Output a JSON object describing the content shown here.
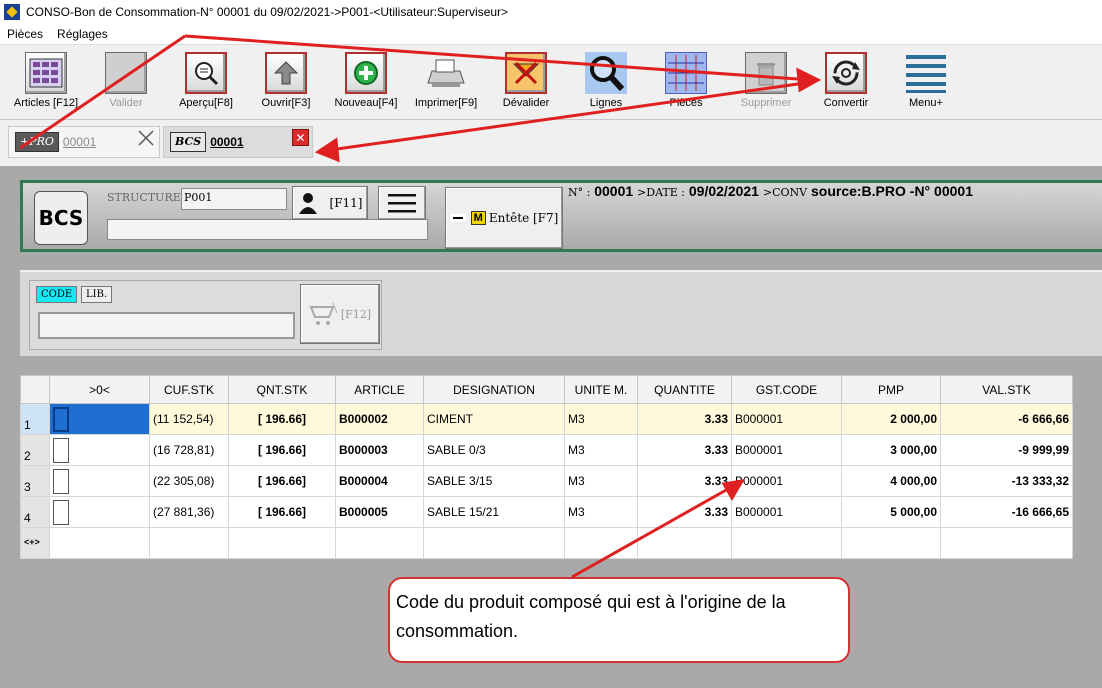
{
  "window": {
    "title": "CONSO-Bon de Consommation-N° 00001 du 09/02/2021->P001-<Utilisateur:Superviseur>"
  },
  "menu": [
    "Pièces",
    "Réglages"
  ],
  "toolbar": [
    {
      "label": "Articles [F12]",
      "icon": "articles-grid-icon",
      "enabled": true
    },
    {
      "label": "Valider",
      "icon": "validate-icon",
      "enabled": false
    },
    {
      "label": "Aperçu[F8]",
      "icon": "preview-magnifier-icon",
      "enabled": true
    },
    {
      "label": "Ouvrir[F3]",
      "icon": "open-arrow-icon",
      "enabled": true
    },
    {
      "label": "Nouveau[F4]",
      "icon": "new-plus-icon",
      "enabled": true
    },
    {
      "label": "Imprimer[F9]",
      "icon": "printer-icon",
      "enabled": true
    },
    {
      "label": "Dévalider",
      "icon": "devalidate-icon",
      "enabled": true
    },
    {
      "label": "Lignes",
      "icon": "lines-magnifier-icon",
      "enabled": true
    },
    {
      "label": "Pièces",
      "icon": "pieces-grid-icon",
      "enabled": true
    },
    {
      "label": "Supprimer",
      "icon": "delete-icon",
      "enabled": false
    },
    {
      "label": "Convertir",
      "icon": "convert-icon",
      "enabled": true
    },
    {
      "label": "Menu+",
      "icon": "menu-lines-icon",
      "enabled": true
    }
  ],
  "tabs": [
    {
      "badge": "+PRO",
      "number": "00001",
      "active": false
    },
    {
      "badge": "BCS",
      "number": "00001",
      "active": true
    }
  ],
  "header": {
    "logo": "BCS",
    "structure_label": "STRUCTURE",
    "structure_value": "P001",
    "user_shortcut": "[F11]",
    "entete_badge": "M",
    "entete_label": "Entête [F7]",
    "no_label": "N° :",
    "no_value": "00001",
    "date_label": ">DATE :",
    "date_value": "09/02/2021",
    "conv_label": ">CONV",
    "conv_value": "source:B.PRO -N° 00001"
  },
  "filter": {
    "code_label": "CODE",
    "lib_label": "LIB.",
    "cart_shortcut": "[F12]"
  },
  "grid": {
    "columns": [
      ">0<",
      "CUF.STK",
      "QNT.STK",
      "ARTICLE",
      "DESIGNATION",
      "UNITE M.",
      "QUANTITE",
      "GST.CODE",
      "PMP",
      "VAL.STK"
    ],
    "rows": [
      {
        "n": "1",
        "cuf": "(11 152,54)",
        "qnt": "[ 196.66]",
        "article": "B000002",
        "designation": "CIMENT",
        "unite": "M3",
        "quantite": "3.33",
        "gst": "B000001",
        "pmp": "2 000,00",
        "val": "-6 666,66"
      },
      {
        "n": "2",
        "cuf": "(16 728,81)",
        "qnt": "[ 196.66]",
        "article": "B000003",
        "designation": "SABLE 0/3",
        "unite": "M3",
        "quantite": "3.33",
        "gst": "B000001",
        "pmp": "3 000,00",
        "val": "-9 999,99"
      },
      {
        "n": "3",
        "cuf": "(22 305,08)",
        "qnt": "[ 196.66]",
        "article": "B000004",
        "designation": "SABLE 3/15",
        "unite": "M3",
        "quantite": "3.33",
        "gst": "B000001",
        "pmp": "4 000,00",
        "val": "-13 333,32"
      },
      {
        "n": "4",
        "cuf": "(27 881,36)",
        "qnt": "[ 196.66]",
        "article": "B000005",
        "designation": "SABLE 15/21",
        "unite": "M3",
        "quantite": "3.33",
        "gst": "B000001",
        "pmp": "5 000,00",
        "val": "-16 666,65"
      }
    ],
    "footer_marker": "<+>"
  },
  "callout": {
    "text_line1": "Code du produit composé qui est à l'origine de la",
    "text_line2": "consommation."
  },
  "colors": {
    "annotation_red": "#e02020",
    "panel_green": "#2f7a55",
    "selected_row": "#fff9dc",
    "selection_blue": "#1f6fd1"
  }
}
